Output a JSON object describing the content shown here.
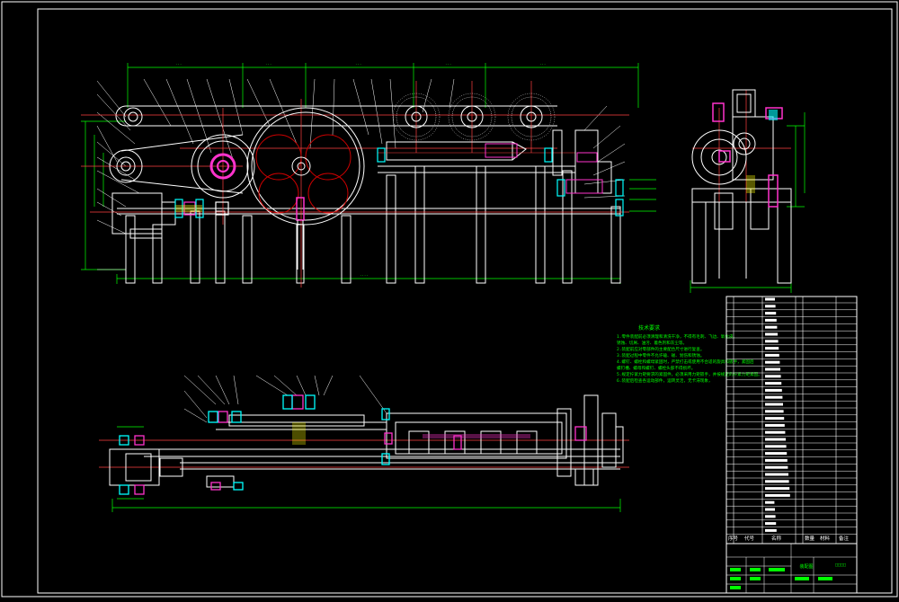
{
  "drawing": {
    "colors": {
      "background": "#000000",
      "outline": "#ffffff",
      "dimension": "#00ff00",
      "centerline": "#ff4040",
      "part": "#ff33cc",
      "bearing": "#00ffff",
      "hatch": "#ffff00"
    },
    "tech_requirements": {
      "title": "技术要求",
      "lines": [
        "1.零件装配前必须清理和清洗干净，不得有毛刺、飞边、氧化皮、",
        "  锈蚀、切屑、油污、着色剂和灰尘等。",
        "2.装配前应对零部件的主要配合尺寸进行复查。",
        "3.装配过程中零件不允许磕、碰、划伤和锈蚀。",
        "4.螺钉、螺栓和螺母紧固时，严禁打击或使用不合适的旋具和扳手，紧固后",
        "  螺钉槽、螺母和螺钉、螺栓头部不得损坏。",
        "5.规定拧紧力矩要求的紧固件，必须采用力矩扳手，并按规定的拧紧力矩紧固。",
        "6.装配后检查各运动部件，运转灵活，无卡滞现象，"
      ]
    },
    "title_block": {
      "name": "装配图",
      "header": [
        "序号",
        "代号",
        "名称",
        "数量",
        "材料",
        "备注"
      ]
    }
  }
}
